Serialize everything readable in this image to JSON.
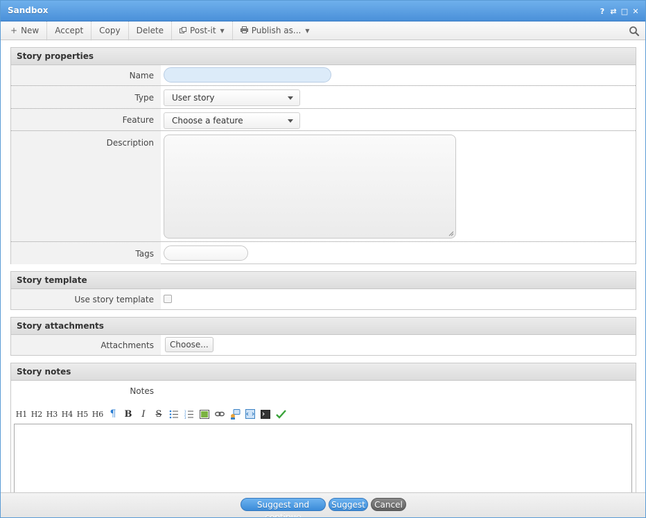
{
  "window": {
    "title": "Sandbox",
    "controls": [
      "?",
      "⇄",
      "□",
      "✕"
    ]
  },
  "toolbar": {
    "new_label": "New",
    "accept_label": "Accept",
    "copy_label": "Copy",
    "delete_label": "Delete",
    "postit_label": "Post-it",
    "publish_label": "Publish as..."
  },
  "story_properties": {
    "heading": "Story properties",
    "name_label": "Name",
    "name_value": "",
    "type_label": "Type",
    "type_value": "User story",
    "feature_label": "Feature",
    "feature_value": "Choose a feature",
    "description_label": "Description",
    "description_value": "",
    "tags_label": "Tags",
    "tags_value": ""
  },
  "story_template": {
    "heading": "Story template",
    "use_label": "Use story template",
    "checked": false
  },
  "story_attachments": {
    "heading": "Story attachments",
    "attachments_label": "Attachments",
    "choose_label": "Choose..."
  },
  "story_notes": {
    "heading": "Story notes",
    "notes_label": "Notes",
    "editor_buttons": [
      "H1",
      "H2",
      "H3",
      "H4",
      "H5",
      "H6",
      "¶",
      "B",
      "I",
      "S"
    ]
  },
  "footer": {
    "suggest_continue_label": "Suggest and continue",
    "suggest_label": "Suggest",
    "cancel_label": "Cancel"
  },
  "colors": {
    "accent": "#4a90d9",
    "button_blue": "#3b8bd8",
    "button_gray": "#5f5f5f",
    "name_field_bg": "#dcebf9"
  }
}
